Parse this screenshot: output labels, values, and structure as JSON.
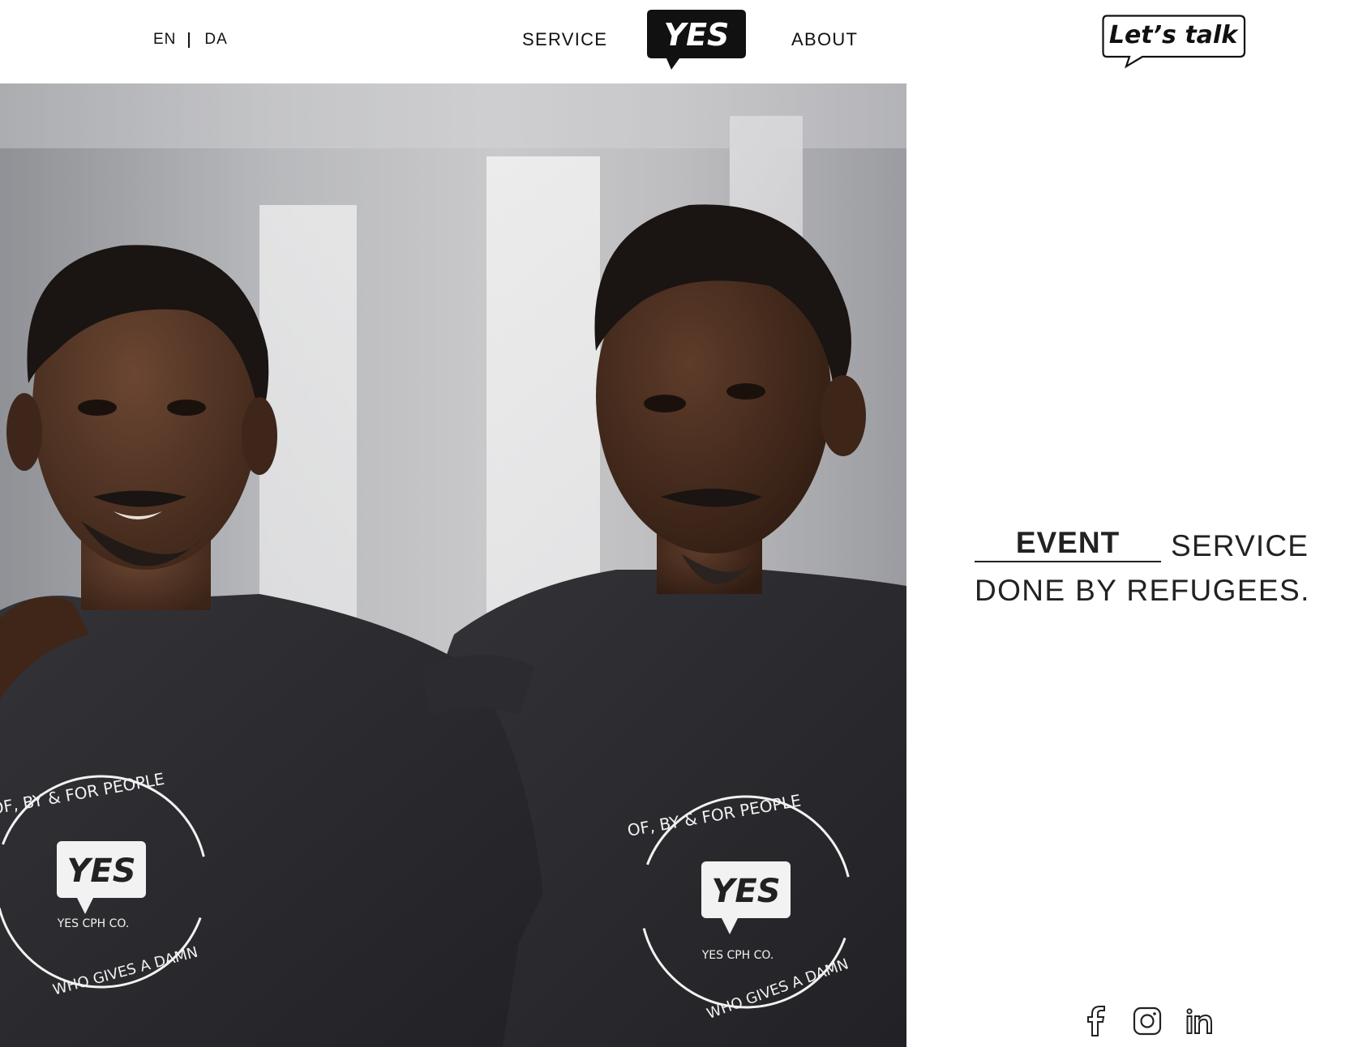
{
  "header": {
    "lang_en": "EN",
    "lang_da": "DA",
    "nav_service": "SERVICE",
    "nav_about": "ABOUT",
    "logo_text": "YES",
    "cta_label": "Let’s talk"
  },
  "hero": {
    "shirt_ring_top": "OF, BY & FOR PEOPLE",
    "shirt_ring_bottom": "WHO GIVES A DAMN",
    "shirt_logo": "YES",
    "shirt_company": "YES CPH CO."
  },
  "tagline": {
    "highlight": "EVENT",
    "line1_rest": "SERVICE",
    "line2": "DONE BY REFUGEES."
  },
  "social": {
    "icons": [
      "facebook-icon",
      "instagram-icon",
      "linkedin-icon"
    ]
  },
  "colors": {
    "background": "#ffffff",
    "text": "#111111",
    "logo_bg": "#111111",
    "shirt": "#2a2a2e"
  }
}
